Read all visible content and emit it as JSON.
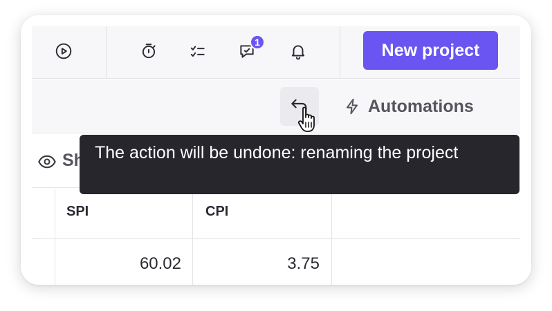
{
  "topbar": {
    "chat_badge_count": "1",
    "new_project_label": "New project",
    "accent_color": "#6a55f2"
  },
  "icons": {
    "play": "play-circle-icon",
    "timer": "timer-icon",
    "checklist": "checklist-icon",
    "chat": "chat-icon",
    "bell": "bell-icon",
    "undo": "undo-icon",
    "bolt": "bolt-icon",
    "eye": "eye-icon"
  },
  "subbar": {
    "automations_label": "Automations"
  },
  "showrow": {
    "label": "Sh"
  },
  "table": {
    "headers": [
      "SPI",
      "CPI"
    ],
    "rows": [
      [
        "60.02",
        "3.75"
      ]
    ]
  },
  "tooltip": {
    "text": "The action will be undone: renaming the project"
  }
}
